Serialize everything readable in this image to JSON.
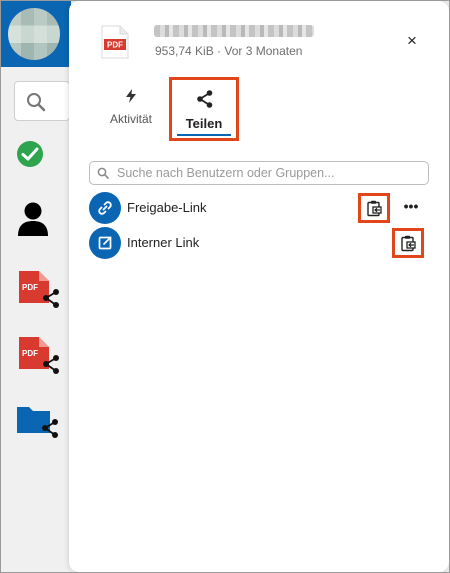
{
  "sidebar": {
    "items": [
      {
        "icon": "search-icon"
      },
      {
        "icon": "check-circle-icon",
        "color": "#2ea44f"
      },
      {
        "icon": "user-icon"
      },
      {
        "icon": "pdf-share-icon",
        "color": "#d93a30"
      },
      {
        "icon": "pdf-share-icon",
        "color": "#d93a30"
      },
      {
        "icon": "folder-share-icon",
        "color": "#0a66b3"
      }
    ]
  },
  "file": {
    "icon_label": "PDF",
    "meta": "953,74 KiB · Vor 3 Monaten"
  },
  "header": {
    "close_label": "×"
  },
  "tabs": [
    {
      "label": "Aktivität",
      "icon": "lightning-icon",
      "active": false
    },
    {
      "label": "Teilen",
      "icon": "share-icon",
      "active": true
    }
  ],
  "search": {
    "placeholder": "Suche nach Benutzern oder Gruppen...",
    "value": ""
  },
  "share_entries": [
    {
      "label": "Freigabe-Link",
      "icon": "link-icon",
      "actions": [
        "copy-icon",
        "more-icon"
      ]
    },
    {
      "label": "Interner Link",
      "icon": "external-link-icon",
      "actions": [
        "copy-icon"
      ]
    }
  ],
  "more_label": "•••",
  "colors": {
    "accent": "#0a66b3",
    "highlight": "#e0461a",
    "pdf_red": "#d93a30",
    "check_green": "#2ea44f"
  }
}
